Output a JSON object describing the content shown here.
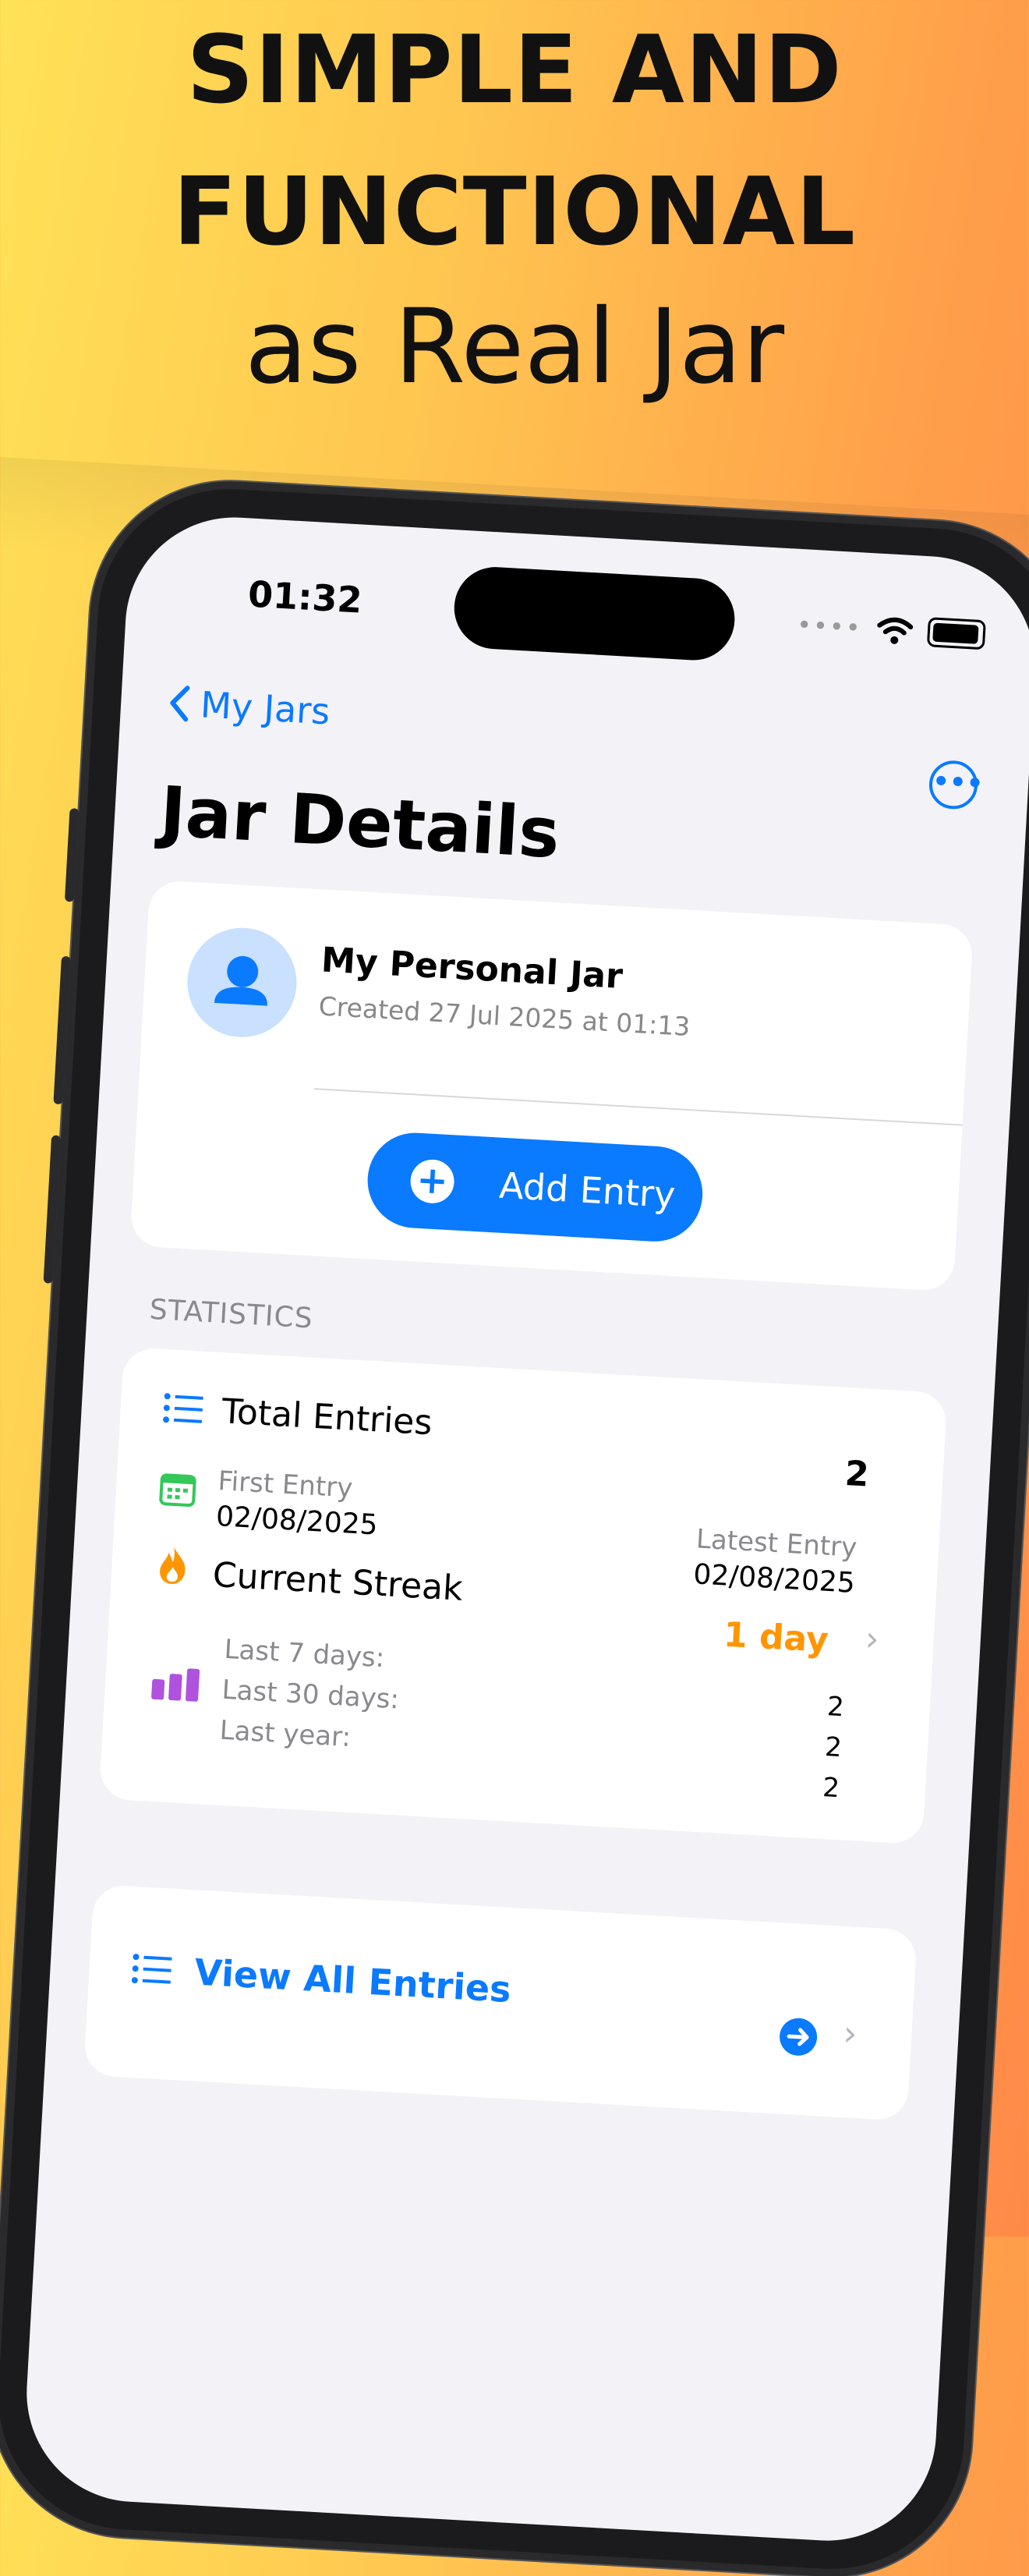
{
  "headline": {
    "line1": "SIMPLE AND",
    "line2": "FUNCTIONAL",
    "line3": "as Real Jar"
  },
  "status": {
    "time": "01:32"
  },
  "nav": {
    "back_label": "My Jars",
    "title": "Jar Details"
  },
  "jar": {
    "name": "My Personal Jar",
    "created": "Created 27 Jul 2025 at 01:13",
    "add_label": "Add Entry"
  },
  "stats": {
    "section": "STATISTICS",
    "total_label": "Total Entries",
    "total_value": "2",
    "first_label": "First Entry",
    "first_value": "02/08/2025",
    "latest_label": "Latest Entry",
    "latest_value": "02/08/2025",
    "streak_label": "Current Streak",
    "streak_value": "1 day",
    "last7_label": "Last 7 days:",
    "last7_value": "2",
    "last30_label": "Last 30 days:",
    "last30_value": "2",
    "lastyear_label": "Last year:",
    "lastyear_value": "2"
  },
  "entries": {
    "view_all_label": "View All Entries"
  },
  "colors": {
    "accent": "#0a7aff",
    "streak": "#ff9500",
    "calendar": "#34c759",
    "chart": "#af52de"
  }
}
